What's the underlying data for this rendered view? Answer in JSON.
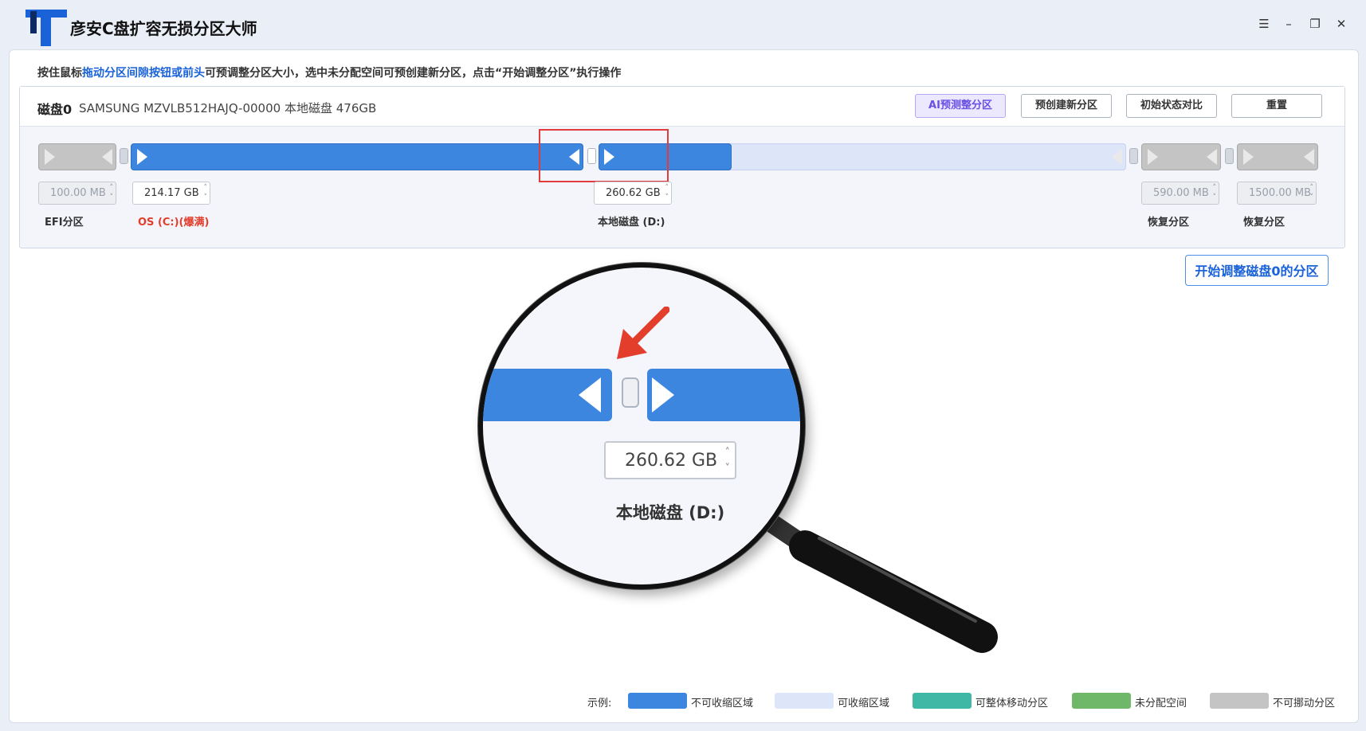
{
  "app": {
    "title": "彦安C盘扩容无损分区大师"
  },
  "window_controls": {
    "menu": "☰",
    "minimize": "–",
    "restore": "❐",
    "close": "✕"
  },
  "instruction": {
    "prefix": "按住鼠标",
    "highlight": "拖动分区间隙按钮或前头",
    "suffix": "可预调整分区大小，选中未分配空间可预创建新分区，点击“开始调整分区”执行操作"
  },
  "disk": {
    "name": "磁盘0",
    "description": "SAMSUNG MZVLB512HAJQ-00000 本地磁盘 476GB",
    "buttons": {
      "ai_predict": "AI预测整分区",
      "pre_create": "预创建新分区",
      "compare": "初始状态对比",
      "reset": "重置"
    },
    "partitions": [
      {
        "size": "100.00 MB",
        "label": "EFI分区"
      },
      {
        "size": "214.17 GB",
        "label": "OS (C:)(爆满)"
      },
      {
        "size": "260.62 GB",
        "label": "本地磁盘 (D:)"
      },
      {
        "size": "590.00 MB",
        "label": "恢复分区"
      },
      {
        "size": "1500.00 MB",
        "label": "恢复分区"
      }
    ]
  },
  "start_button": "开始调整磁盘0的分区",
  "magnifier": {
    "size": "260.62 GB",
    "label": "本地磁盘 (D:)"
  },
  "legend": {
    "title": "示例:",
    "items": [
      {
        "label": "不可收缩区域",
        "color": "#3c86e0"
      },
      {
        "label": "可收缩区域",
        "color": "#dde5f8"
      },
      {
        "label": "可整体移动分区",
        "color": "#3fb8a5"
      },
      {
        "label": "未分配空间",
        "color": "#6fb86a"
      },
      {
        "label": "不可挪动分区",
        "color": "#c4c4c4"
      }
    ]
  },
  "colors": {
    "accent": "#1a62d8",
    "partition_blue": "#3c86e0",
    "warning_red": "#e33d2c"
  }
}
